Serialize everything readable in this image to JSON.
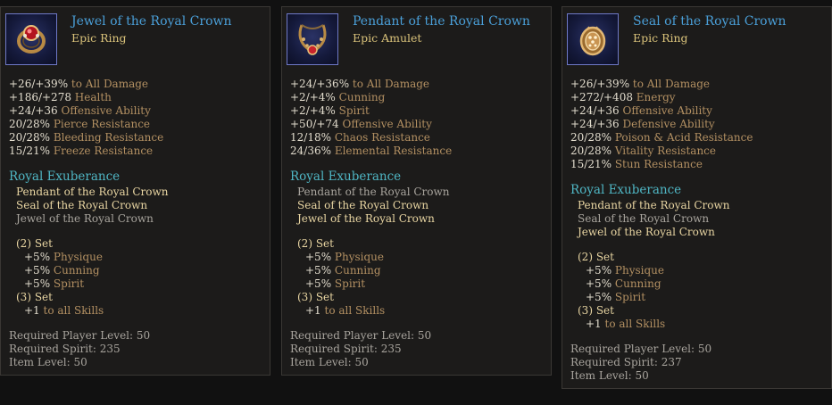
{
  "cards": [
    {
      "title": "Jewel of the Royal Crown",
      "subtitle": "Epic Ring",
      "icon": "ring-icon",
      "stats": [
        {
          "value": "+26/+39%",
          "label": "to All Damage"
        },
        {
          "value": "+186/+278",
          "label": "Health"
        },
        {
          "value": "+24/+36",
          "label": "Offensive Ability"
        },
        {
          "value": "20/28%",
          "label": "Pierce Resistance"
        },
        {
          "value": "20/28%",
          "label": "Bleeding Resistance"
        },
        {
          "value": "15/21%",
          "label": "Freeze Resistance"
        }
      ],
      "set_name": "Royal Exuberance",
      "pieces": [
        {
          "name": "Pendant of the Royal Crown",
          "owned": true
        },
        {
          "name": "Seal of the Royal Crown",
          "owned": true
        },
        {
          "name": "Jewel of the Royal Crown",
          "owned": false
        }
      ],
      "set2_label": "(2) Set",
      "set2_bonuses": [
        {
          "value": "+5%",
          "label": "Physique"
        },
        {
          "value": "+5%",
          "label": "Cunning"
        },
        {
          "value": "+5%",
          "label": "Spirit"
        }
      ],
      "set3_label": "(3) Set",
      "set3_bonuses": [
        {
          "value": "+1",
          "label": "to all Skills"
        }
      ],
      "requirements": [
        "Required Player Level: 50",
        "Required Spirit: 235",
        "Item Level: 50"
      ]
    },
    {
      "title": "Pendant of the Royal Crown",
      "subtitle": "Epic Amulet",
      "icon": "amulet-icon",
      "stats": [
        {
          "value": "+24/+36%",
          "label": "to All Damage"
        },
        {
          "value": "+2/+4%",
          "label": "Cunning"
        },
        {
          "value": "+2/+4%",
          "label": "Spirit"
        },
        {
          "value": "+50/+74",
          "label": "Offensive Ability"
        },
        {
          "value": "12/18%",
          "label": "Chaos Resistance"
        },
        {
          "value": "24/36%",
          "label": "Elemental Resistance"
        }
      ],
      "set_name": "Royal Exuberance",
      "pieces": [
        {
          "name": "Pendant of the Royal Crown",
          "owned": false
        },
        {
          "name": "Seal of the Royal Crown",
          "owned": true
        },
        {
          "name": "Jewel of the Royal Crown",
          "owned": true
        }
      ],
      "set2_label": "(2) Set",
      "set2_bonuses": [
        {
          "value": "+5%",
          "label": "Physique"
        },
        {
          "value": "+5%",
          "label": "Cunning"
        },
        {
          "value": "+5%",
          "label": "Spirit"
        }
      ],
      "set3_label": "(3) Set",
      "set3_bonuses": [
        {
          "value": "+1",
          "label": "to all Skills"
        }
      ],
      "requirements": [
        "Required Player Level: 50",
        "Required Spirit: 235",
        "Item Level: 50"
      ]
    },
    {
      "title": "Seal of the Royal Crown",
      "subtitle": "Epic Ring",
      "icon": "seal-ring-icon",
      "stats": [
        {
          "value": "+26/+39%",
          "label": "to All Damage"
        },
        {
          "value": "+272/+408",
          "label": "Energy"
        },
        {
          "value": "+24/+36",
          "label": "Offensive Ability"
        },
        {
          "value": "+24/+36",
          "label": "Defensive Ability"
        },
        {
          "value": "20/28%",
          "label": "Poison & Acid Resistance"
        },
        {
          "value": "20/28%",
          "label": "Vitality Resistance"
        },
        {
          "value": "15/21%",
          "label": "Stun Resistance"
        }
      ],
      "set_name": "Royal Exuberance",
      "pieces": [
        {
          "name": "Pendant of the Royal Crown",
          "owned": true
        },
        {
          "name": "Seal of the Royal Crown",
          "owned": false
        },
        {
          "name": "Jewel of the Royal Crown",
          "owned": true
        }
      ],
      "set2_label": "(2) Set",
      "set2_bonuses": [
        {
          "value": "+5%",
          "label": "Physique"
        },
        {
          "value": "+5%",
          "label": "Cunning"
        },
        {
          "value": "+5%",
          "label": "Spirit"
        }
      ],
      "set3_label": "(3) Set",
      "set3_bonuses": [
        {
          "value": "+1",
          "label": "to all Skills"
        }
      ],
      "requirements": [
        "Required Player Level: 50",
        "Required Spirit: 237",
        "Item Level: 50"
      ]
    }
  ]
}
